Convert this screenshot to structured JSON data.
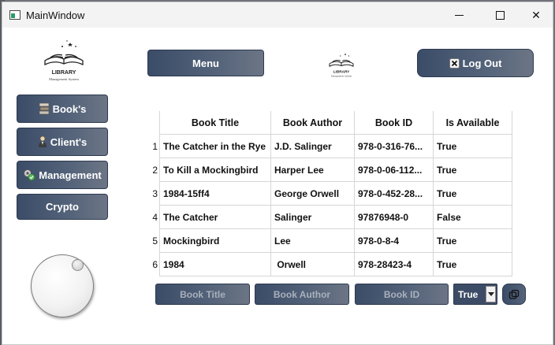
{
  "window": {
    "title": "MainWindow",
    "controls": {
      "minimize_icon": "minimize-icon",
      "maximize_icon": "maximize-icon",
      "close_glyph": "✕"
    }
  },
  "header": {
    "logo_title": "LIBRARY",
    "logo_subtitle": "Management System",
    "menu_label": "Menu",
    "logout_label": "Log Out",
    "logout_icon": "close-x-icon"
  },
  "sidebar": {
    "items": [
      {
        "label": "Book's",
        "icon": "books-icon"
      },
      {
        "label": "Client's",
        "icon": "person-icon"
      },
      {
        "label": "Management",
        "icon": "gear-tools-icon"
      },
      {
        "label": "Crypto",
        "icon": ""
      }
    ]
  },
  "dial": {
    "icon": "dial-knob"
  },
  "table": {
    "columns": [
      "Book Title",
      "Book Author",
      "Book ID",
      "Is Available"
    ],
    "rows": [
      {
        "num": "1",
        "title": "The Catcher in the Rye",
        "author": "J.D. Salinger",
        "id": "978-0-316-76...",
        "available": "True"
      },
      {
        "num": "2",
        "title": "To Kill a Mockingbird",
        "author": "Harper Lee",
        "id": "978-0-06-112...",
        "available": "True"
      },
      {
        "num": "3",
        "title": "1984-15ff4",
        "author": "George Orwell",
        "id": "978-0-452-28...",
        "available": "True"
      },
      {
        "num": "4",
        "title": "The Catcher",
        "author": "Salinger",
        "id": "97876948-0",
        "available": "False"
      },
      {
        "num": "5",
        "title": "Mockingbird",
        "author": "Lee",
        "id": "978-0-8-4",
        "available": "True"
      },
      {
        "num": "6",
        "title": "1984",
        "author": " Orwell",
        "id": "978-28423-4",
        "available": "True"
      }
    ]
  },
  "filters": {
    "title_placeholder": "Book Title",
    "author_placeholder": "Book Author",
    "id_placeholder": "Book ID",
    "available_value": "True",
    "copy_icon": "copy-icon"
  },
  "colors": {
    "button_dark": "#3b4c68",
    "button_light": "#6c7585",
    "placeholder_text": "#a9b0bc"
  }
}
